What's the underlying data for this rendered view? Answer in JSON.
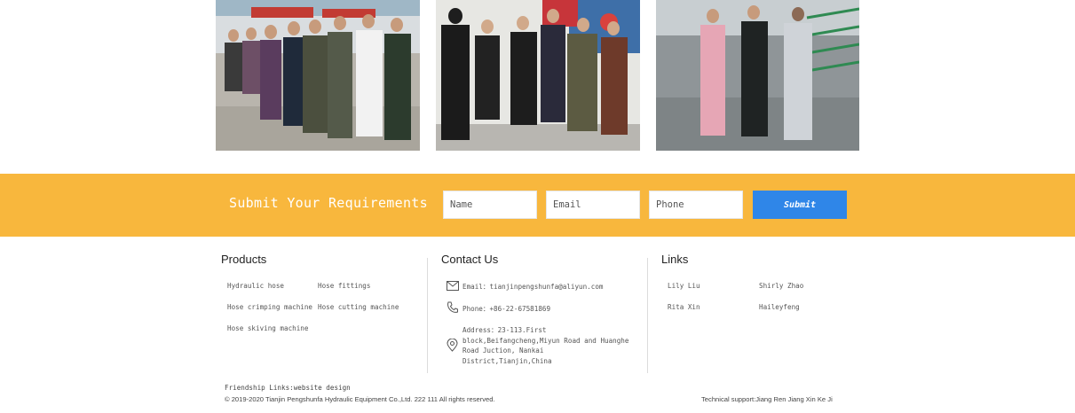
{
  "photos": [
    {
      "alt": "group-photo"
    },
    {
      "alt": "group-photo"
    },
    {
      "alt": "group-photo"
    }
  ],
  "banner": {
    "title": "Submit Your Requirements",
    "name_placeholder": "Name",
    "email_placeholder": "Email",
    "phone_placeholder": "Phone",
    "submit_label": "Submit",
    "background_color": "#f8b73d",
    "button_color": "#2f86e8"
  },
  "products": {
    "title": "Products",
    "items": [
      "Hydraulic hose",
      "Hose fittings",
      "Hose crimping machine",
      "Hose cutting machine",
      "Hose skiving machine"
    ]
  },
  "contact": {
    "title": "Contact Us",
    "email_label": "Email：",
    "email": "tianjinpengshunfa@aliyun.com",
    "phone_label": "Phone：",
    "phone": "+86-22-67581869",
    "address_label": "Address：",
    "address": "23-113.First block,Beifangcheng,Miyun Road and Huanghe Road Juction, Nankai District,Tianjin,China",
    "icons": [
      "mail-icon",
      "phone-icon",
      "location-icon"
    ]
  },
  "links": {
    "title": "Links",
    "items": [
      "Lily Liu",
      "Shirly Zhao",
      "Rita Xin",
      "Haileyfeng"
    ]
  },
  "footer": {
    "friendship_label": "Friendship Links:",
    "friendship_link": "website design",
    "copyright": "© 2019-2020 Tianjin Pengshunfa Hydraulic Equipment Co.,Ltd. 222 111 All rights reserved.",
    "support_label": "Technical support:",
    "support_name": "Jiang Ren Jiang Xin Ke Ji"
  }
}
